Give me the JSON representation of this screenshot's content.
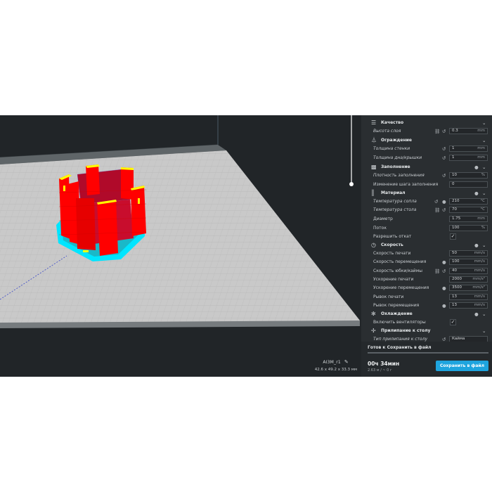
{
  "model": {
    "name": "AI3M_r1",
    "dimensions": "42.6 x 49.2 x 33.3 мм"
  },
  "icons": {
    "edit": "pencil-icon"
  },
  "settings": {
    "quality": {
      "title": "Качество",
      "layer_height": {
        "label": "Высота слоя",
        "value": "0.3",
        "unit": "mm"
      }
    },
    "shell": {
      "title": "Ограждение",
      "wall_thickness": {
        "label": "Толщина стенки",
        "value": "1",
        "unit": "mm"
      },
      "top_bottom_thickness": {
        "label": "Толщина дна/крышки",
        "value": "1",
        "unit": "mm"
      }
    },
    "infill": {
      "title": "Заполнение",
      "density": {
        "label": "Плотность заполнения",
        "value": "10",
        "unit": "%"
      },
      "gradual_steps": {
        "label": "Изменение шага заполнения",
        "value": "0",
        "unit": ""
      }
    },
    "material": {
      "title": "Материал",
      "nozzle_temp": {
        "label": "Температура сопла",
        "value": "210",
        "unit": "°C"
      },
      "bed_temp": {
        "label": "Температура стола",
        "value": "70",
        "unit": "°C"
      },
      "diameter": {
        "label": "Диаметр",
        "value": "1.75",
        "unit": "mm"
      },
      "flow": {
        "label": "Поток",
        "value": "100",
        "unit": "%"
      },
      "retraction": {
        "label": "Разрешить откат",
        "checked": "✓"
      }
    },
    "speed": {
      "title": "Скорость",
      "print_speed": {
        "label": "Скорость печати",
        "value": "50",
        "unit": "mm/s"
      },
      "travel_speed": {
        "label": "Скорость перемещения",
        "value": "100",
        "unit": "mm/s"
      },
      "skirt_speed": {
        "label": "Скорость юбки/каймы",
        "value": "40",
        "unit": "mm/s"
      },
      "print_accel": {
        "label": "Ускорение печати",
        "value": "2000",
        "unit": "mm/s²"
      },
      "travel_accel": {
        "label": "Ускорение перемещения",
        "value": "3500",
        "unit": "mm/s²"
      },
      "print_jerk": {
        "label": "Рывок печати",
        "value": "13",
        "unit": "mm/s"
      },
      "travel_jerk": {
        "label": "Рывок перемещения",
        "value": "13",
        "unit": "mm/s"
      }
    },
    "cooling": {
      "title": "Охлаждение",
      "fans": {
        "label": "Включить вентиляторы",
        "checked": "✓"
      }
    },
    "adhesion": {
      "title": "Прилипание к столу",
      "type": {
        "label": "Тип прилипания к столу",
        "value": "Кайма"
      }
    }
  },
  "footer": {
    "status": "Готов к Сохранить в файл",
    "progress": 1.0,
    "time": "00ч 34мин",
    "material_usage": "2.63 м / ~ 0 г",
    "save_button": "Сохранить в файл"
  },
  "colors": {
    "accent": "#1ea4de",
    "model_wall": "#ff0000",
    "model_top": "#ffff00",
    "brim": "#00ffff"
  }
}
